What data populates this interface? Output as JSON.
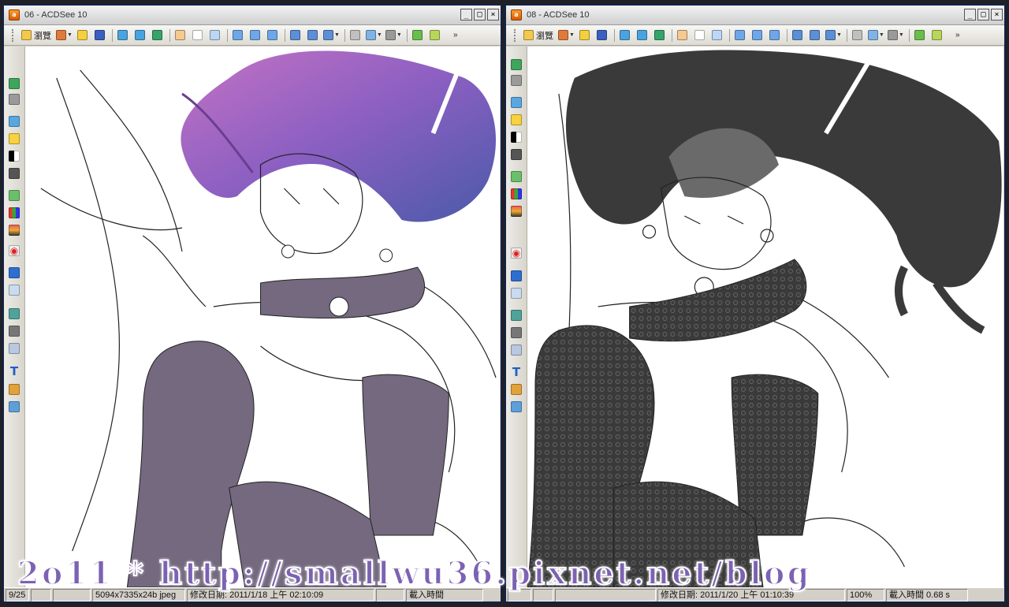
{
  "windows": [
    {
      "title": "06 - ACDSee 10",
      "toolbar": {
        "browse_label": "瀏覽"
      },
      "status": {
        "index": "9/25",
        "size": "",
        "dims": "5094x7335x24b jpeg",
        "date": "修改日期: 2011/1/18 上午 02:10:09",
        "zoom": "",
        "load": "載入時間"
      }
    },
    {
      "title": "08 - ACDSee 10",
      "toolbar": {
        "browse_label": "瀏覽"
      },
      "status": {
        "index": "",
        "size": "",
        "dims": "",
        "date": "修改日期: 2011/1/20 上午 01:10:39",
        "zoom": "100%",
        "load": "載入時間 0.68 s"
      }
    }
  ],
  "window_buttons": {
    "minimize": "_",
    "maximize": "□",
    "close": "×"
  },
  "toolbar_icons": [
    "browse-icon",
    "edit-icon",
    "open-folder-icon",
    "save-icon",
    "previous-image-icon",
    "next-image-icon",
    "auto-advance-icon",
    "hand-tool-icon",
    "selection-tool-icon",
    "zoom-tool-icon",
    "fit-image-icon",
    "rotate-left-icon",
    "rotate-right-icon",
    "zoom-in-icon",
    "zoom-out-icon",
    "zoom-dropdown-icon",
    "print-icon",
    "send-icon",
    "options-icon",
    "export-icon",
    "share-icon"
  ],
  "sidebar_icons": [
    "undo-icon",
    "redo-icon",
    "crop-icon",
    "exposure-icon",
    "levels-icon",
    "tone-icon",
    "color-balance-icon",
    "histogram-icon",
    "noise-icon",
    "red-eye-icon",
    "sharpen-icon",
    "blur-icon",
    "effects-icon",
    "rotate-icon",
    "clone-icon",
    "text-icon",
    "repair-icon",
    "settings-icon"
  ],
  "watermark": {
    "text": "2o11 * http://smallwu36.pixnet.net/blog",
    "color": "#7c62b3"
  },
  "colors": {
    "hair_color": "#8a5fc2",
    "clothing_color": "#74697f",
    "greyscale_dark": "#3a3a3a",
    "title_accent": "#0a246a"
  }
}
